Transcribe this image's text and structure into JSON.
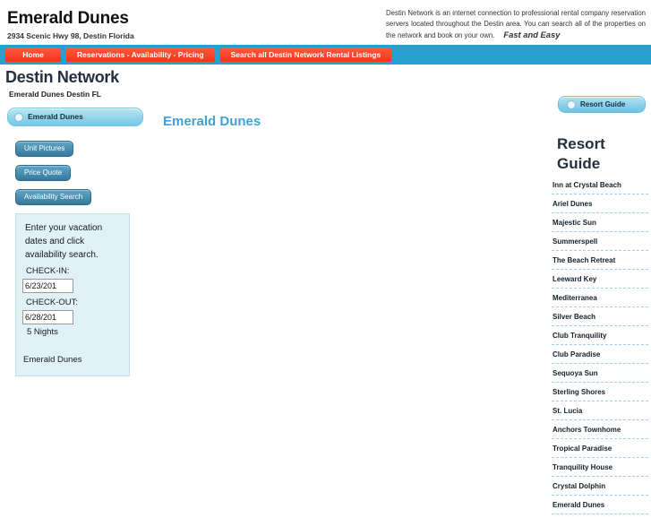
{
  "header": {
    "brand_title": "Emerald Dunes",
    "brand_address": "2934 Scenic Hwy 98, Destin Florida",
    "blurb": "Destin Network is an internet connection to professional rental company reservation servers located throughout the Destin area. You can search all of the properties on the network and book on your own.",
    "tagline": "Fast and Easy"
  },
  "nav": {
    "items": [
      {
        "label": "Home"
      },
      {
        "label": "Reservations - Availability - Pricing"
      },
      {
        "label": "Search all Destin Network Rental Listings"
      }
    ]
  },
  "page": {
    "title": "Destin Network",
    "subtitle": "Emerald Dunes Destin FL"
  },
  "left": {
    "property_pill": "Emerald Dunes",
    "buttons": [
      {
        "label": "Unit Pictures"
      },
      {
        "label": "Price Quote"
      },
      {
        "label": "Availability Search"
      }
    ],
    "vacation_box": {
      "instructions": "Enter your vacation dates and click availability search.",
      "checkin_label": "CHECK-IN:",
      "checkin_value": "6/23/201",
      "checkout_label": "CHECK-OUT:",
      "checkout_value": "6/28/201",
      "nights": "5  Nights",
      "resort_name": "Emerald Dunes"
    }
  },
  "center": {
    "heading": "Emerald Dunes"
  },
  "right": {
    "pill_label": "Resort Guide",
    "guide_title": "Resort Guide",
    "items": [
      {
        "label": "Inn at Crystal Beach"
      },
      {
        "label": "Ariel Dunes"
      },
      {
        "label": "Majestic Sun"
      },
      {
        "label": "Summerspell"
      },
      {
        "label": "The Beach Retreat"
      },
      {
        "label": "Leeward Key"
      },
      {
        "label": "Mediterranea"
      },
      {
        "label": "Silver Beach"
      },
      {
        "label": "Club Tranquility"
      },
      {
        "label": "Club Paradise"
      },
      {
        "label": "Sequoya Sun"
      },
      {
        "label": "Sterling Shores"
      },
      {
        "label": "St. Lucia"
      },
      {
        "label": "Anchors Townhome"
      },
      {
        "label": "Tropical Paradise"
      },
      {
        "label": "Tranquility House"
      },
      {
        "label": "Crystal Dolphin"
      },
      {
        "label": "Emerald Dunes"
      }
    ]
  },
  "colors": {
    "nav_bar": "#27a0cd",
    "nav_button": "#fc4429",
    "heading": "#252f3d",
    "accent_blue": "#3ea2d8",
    "panel_bg": "#e0f1f7"
  }
}
